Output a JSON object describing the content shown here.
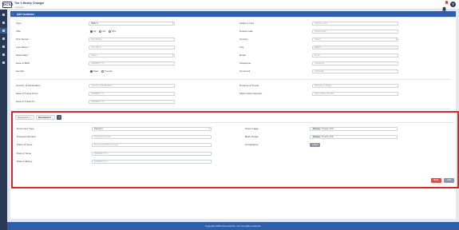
{
  "app": {
    "logo": "DCSX",
    "title": "Tier 1 Money Changer",
    "subtitle": "Customer",
    "help_icon": "question-icon",
    "bell_icon": "bell-icon"
  },
  "header": {
    "title": "Add Customer",
    "back_icon": "chevron-left-icon"
  },
  "sidebar": {
    "items": [
      "home-icon",
      "list-icon",
      "user-icon",
      "file-icon",
      "transfer-icon",
      "report-icon",
      "settings-icon"
    ]
  },
  "form": {
    "type": {
      "label": "Type",
      "value": "Walk In"
    },
    "title": {
      "label": "Title",
      "options": [
        "Mr",
        "Ms",
        "Mrs"
      ],
      "selected": "Mr"
    },
    "first_name": {
      "label": "First Name*",
      "placeholder": "First Name"
    },
    "last_name": {
      "label": "Last Name*",
      "placeholder": "Last Name"
    },
    "nationality": {
      "label": "Nationality*",
      "value": "Select"
    },
    "dob": {
      "label": "Date of Birth",
      "placeholder": "DD/MM/YYYY"
    },
    "gender": {
      "label": "Gender",
      "options": [
        "Male",
        "Female"
      ],
      "selected": "Male"
    },
    "address": {
      "label": "Address Line",
      "placeholder": "Address Line"
    },
    "postal": {
      "label": "Postal Code",
      "placeholder": "Postal Code"
    },
    "country": {
      "label": "Country",
      "value": "Select"
    },
    "city": {
      "label": "City",
      "value": "Select"
    },
    "email": {
      "label": "Email",
      "placeholder": "Email"
    },
    "telephone": {
      "label": "Telephone",
      "placeholder": "Telephone"
    },
    "comment": {
      "label": "Comment",
      "placeholder": "(Optional)"
    },
    "destination": {
      "label": "Country of Destination",
      "placeholder": "Country of Destination"
    },
    "travel_from": {
      "label": "Date of Travel From",
      "placeholder": "DD/MM/YYYY"
    },
    "travel_to": {
      "label": "Date of Travel To",
      "placeholder": "DD/MM/YYYY"
    },
    "purpose": {
      "label": "Purpose of Travel",
      "placeholder": "Purpose of Travel"
    },
    "flight": {
      "label": "Flight Ticket Number",
      "placeholder": "Flight Ticket Number"
    }
  },
  "documents": {
    "tabs": [
      {
        "label": "Document 1",
        "close": "×"
      },
      {
        "label": "Document 2",
        "close": "×"
      }
    ],
    "add_label": "+",
    "doc_type": {
      "label": "Document Type",
      "value": "Passport"
    },
    "passport_no": {
      "label": "Passport Number",
      "placeholder": "Passport Number"
    },
    "place_issue": {
      "label": "Place of Issue",
      "placeholder": "Document Place of Issue"
    },
    "date_issue": {
      "label": "Date of Issue",
      "placeholder": "DD/MM/YYYY"
    },
    "date_expiry": {
      "label": "Date of Expiry",
      "placeholder": "DD/MM/YYYY"
    },
    "front": {
      "label": "Front Image",
      "button": "Browse",
      "text": "Choose a file"
    },
    "back": {
      "label": "Back Image",
      "button": "Browse",
      "text": "Choose a file"
    },
    "compliance": {
      "label": "Compliance",
      "button": "Check"
    }
  },
  "actions": {
    "back": "Back",
    "add": "Add"
  },
  "footer": {
    "text": "Copyright 2018 dcsx.link Pte. Ltd. All rights reserved."
  }
}
